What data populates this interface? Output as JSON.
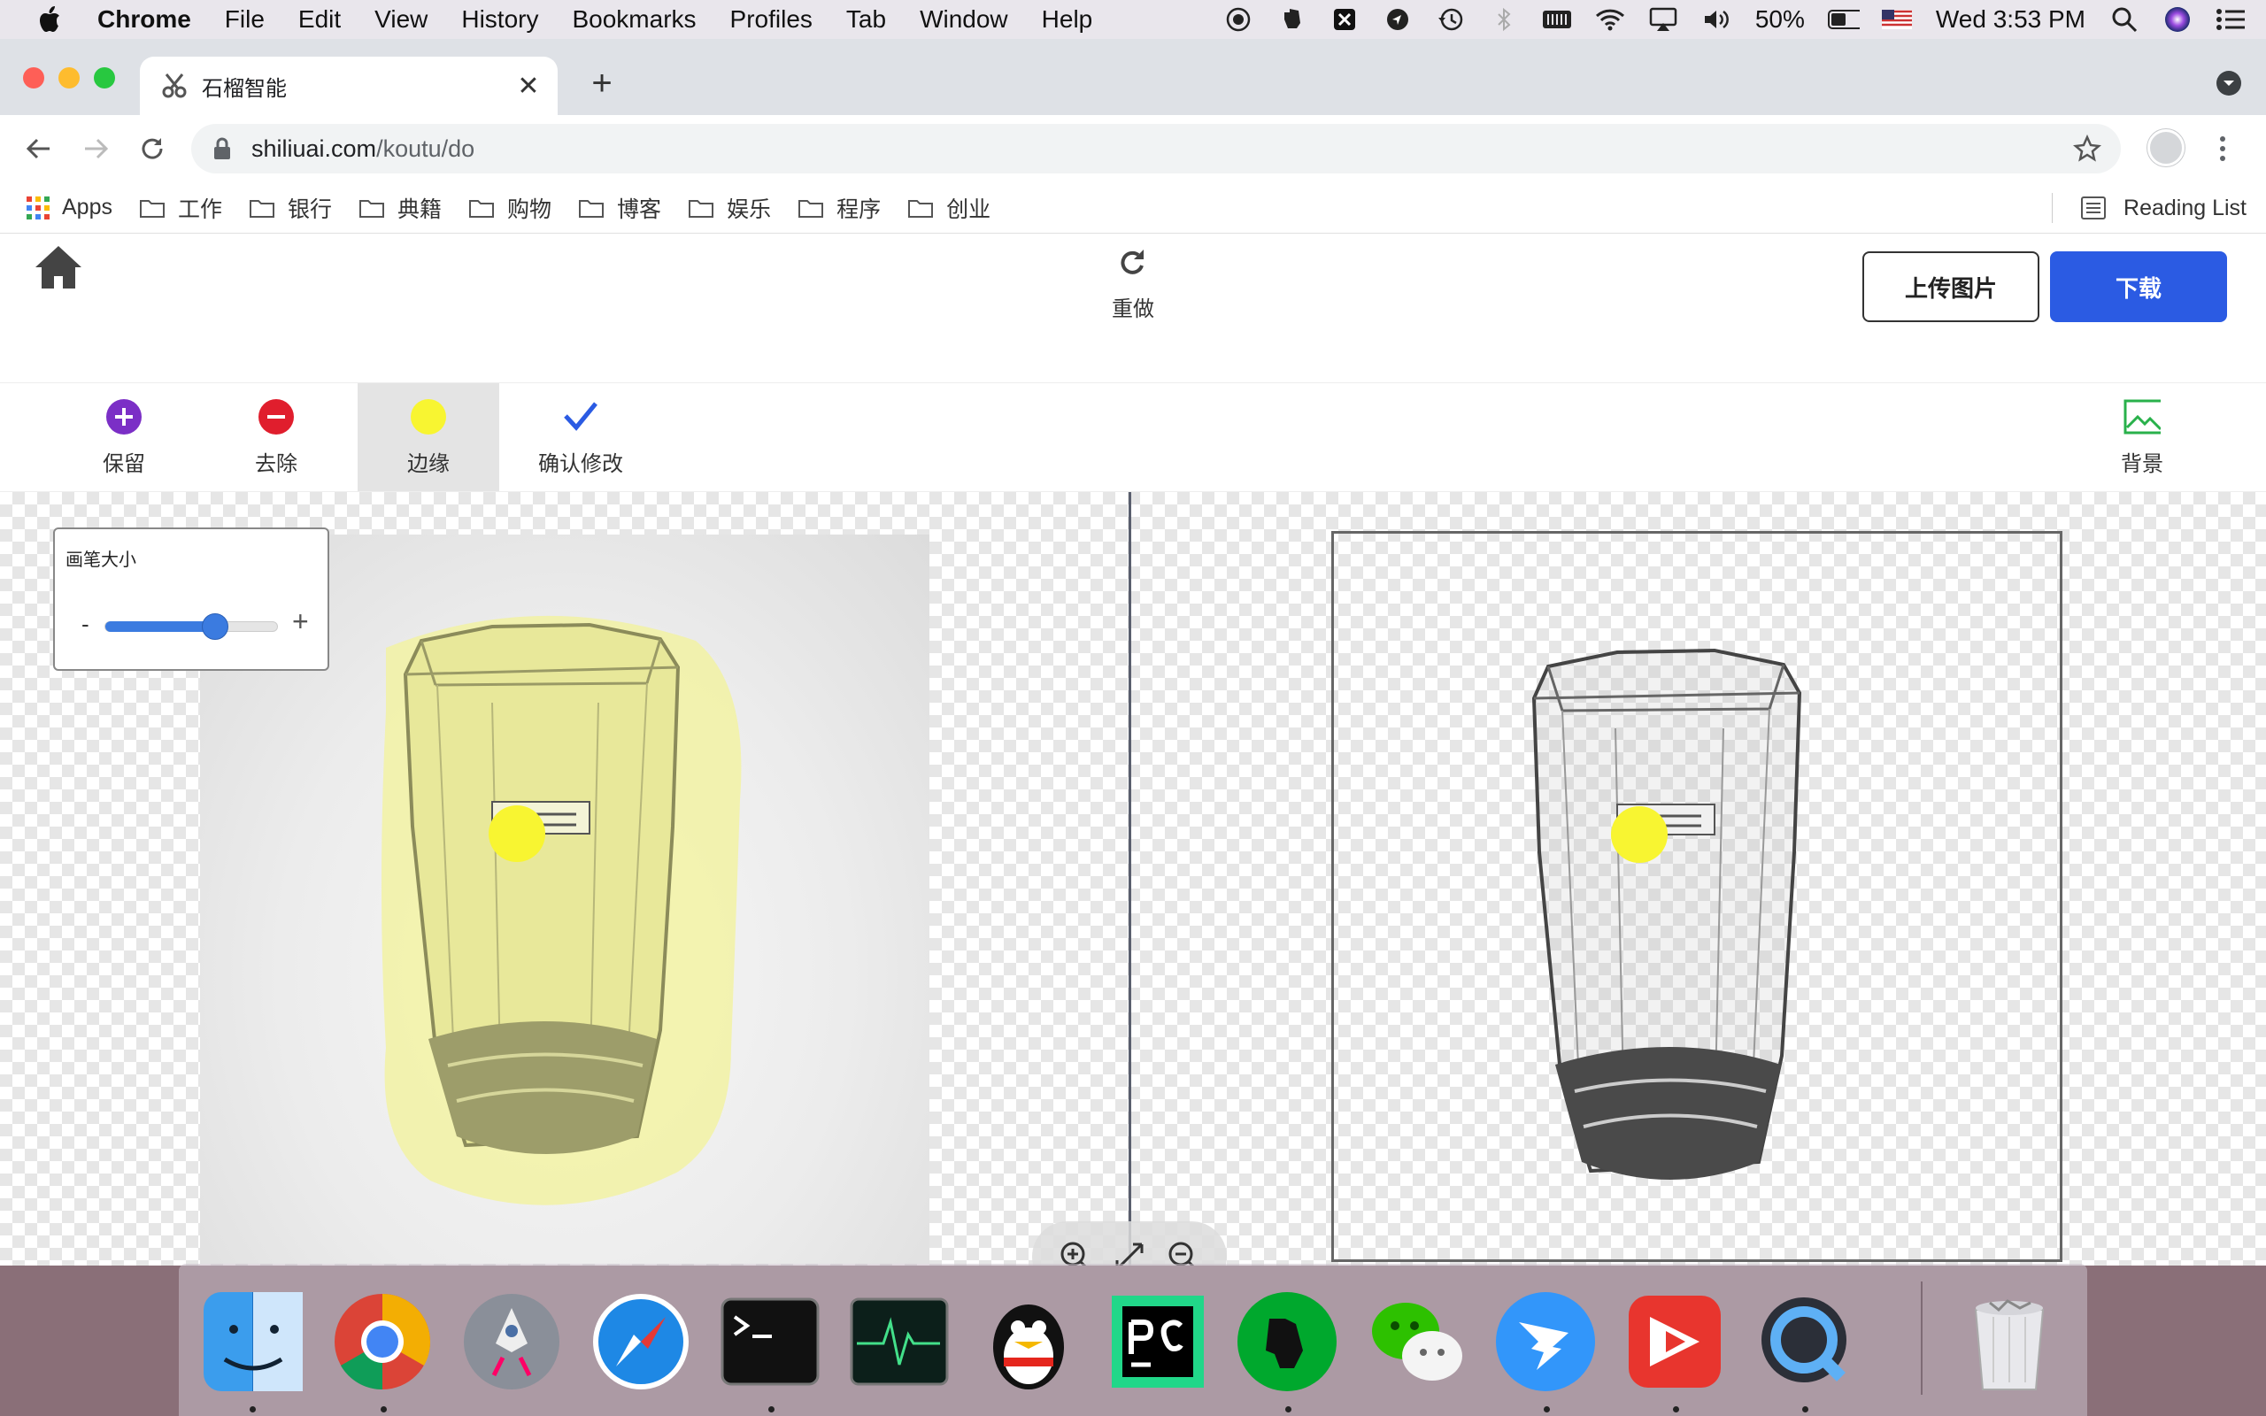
{
  "menubar": {
    "app": "Chrome",
    "items": [
      "File",
      "Edit",
      "View",
      "History",
      "Bookmarks",
      "Profiles",
      "Tab",
      "Window",
      "Help"
    ],
    "battery": "50%",
    "datetime": "Wed 3:53 PM"
  },
  "browser": {
    "tab_title": "石榴智能",
    "url_host": "shiliuai.com",
    "url_path": "/koutu/do",
    "bookmarks": [
      "Apps",
      "工作",
      "银行",
      "典籍",
      "购物",
      "博客",
      "娱乐",
      "程序",
      "创业"
    ],
    "reading_list": "Reading List"
  },
  "page": {
    "redo_label": "重做",
    "upload_label": "上传图片",
    "download_label": "下载",
    "tools": {
      "keep": "保留",
      "remove": "去除",
      "edge": "边缘",
      "confirm": "确认修改",
      "background": "背景"
    },
    "brush": {
      "title": "画笔大小",
      "minus": "-",
      "plus": "+",
      "level": 0.64
    },
    "colors": {
      "accent": "#2b5be3",
      "keep": "#7b2fc6",
      "remove": "#e01e2d",
      "edge": "#f8f531",
      "background_icon": "#29b14b"
    }
  }
}
